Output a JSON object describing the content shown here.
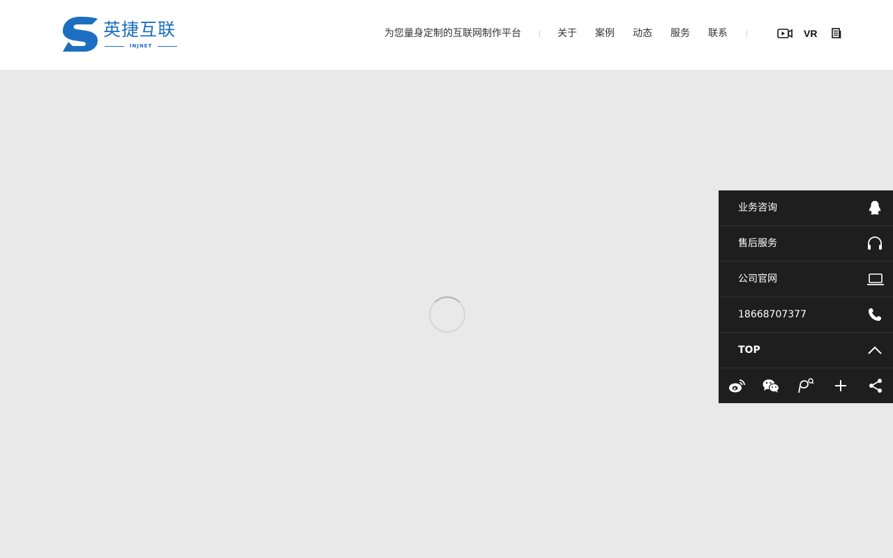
{
  "header": {
    "logo": {
      "name_cn": "英捷互联",
      "name_en": "INJNET",
      "brand_color": "#1c6fc0"
    },
    "slogan": "为您量身定制的互联网制作平台",
    "nav": [
      {
        "label": "关于"
      },
      {
        "label": "案例"
      },
      {
        "label": "动态"
      },
      {
        "label": "服务"
      },
      {
        "label": "联系"
      }
    ],
    "icons": {
      "video": "video-icon",
      "vr_label": "VR",
      "doc": "document-icon"
    }
  },
  "main": {
    "loading": "loading-spinner"
  },
  "sidebar": {
    "background": "#1e1e1e",
    "items": [
      {
        "label": "业务咨询",
        "icon": "qq-icon"
      },
      {
        "label": "售后服务",
        "icon": "headphones-icon"
      },
      {
        "label": "公司官网",
        "icon": "laptop-icon"
      },
      {
        "label": "18668707377",
        "icon": "phone-icon"
      },
      {
        "label": "TOP",
        "icon": "chevron-up-icon"
      }
    ],
    "share": [
      {
        "icon": "weibo-icon"
      },
      {
        "icon": "wechat-icon"
      },
      {
        "icon": "search-pin-icon"
      },
      {
        "icon": "plus-icon"
      },
      {
        "icon": "share-icon"
      }
    ]
  }
}
